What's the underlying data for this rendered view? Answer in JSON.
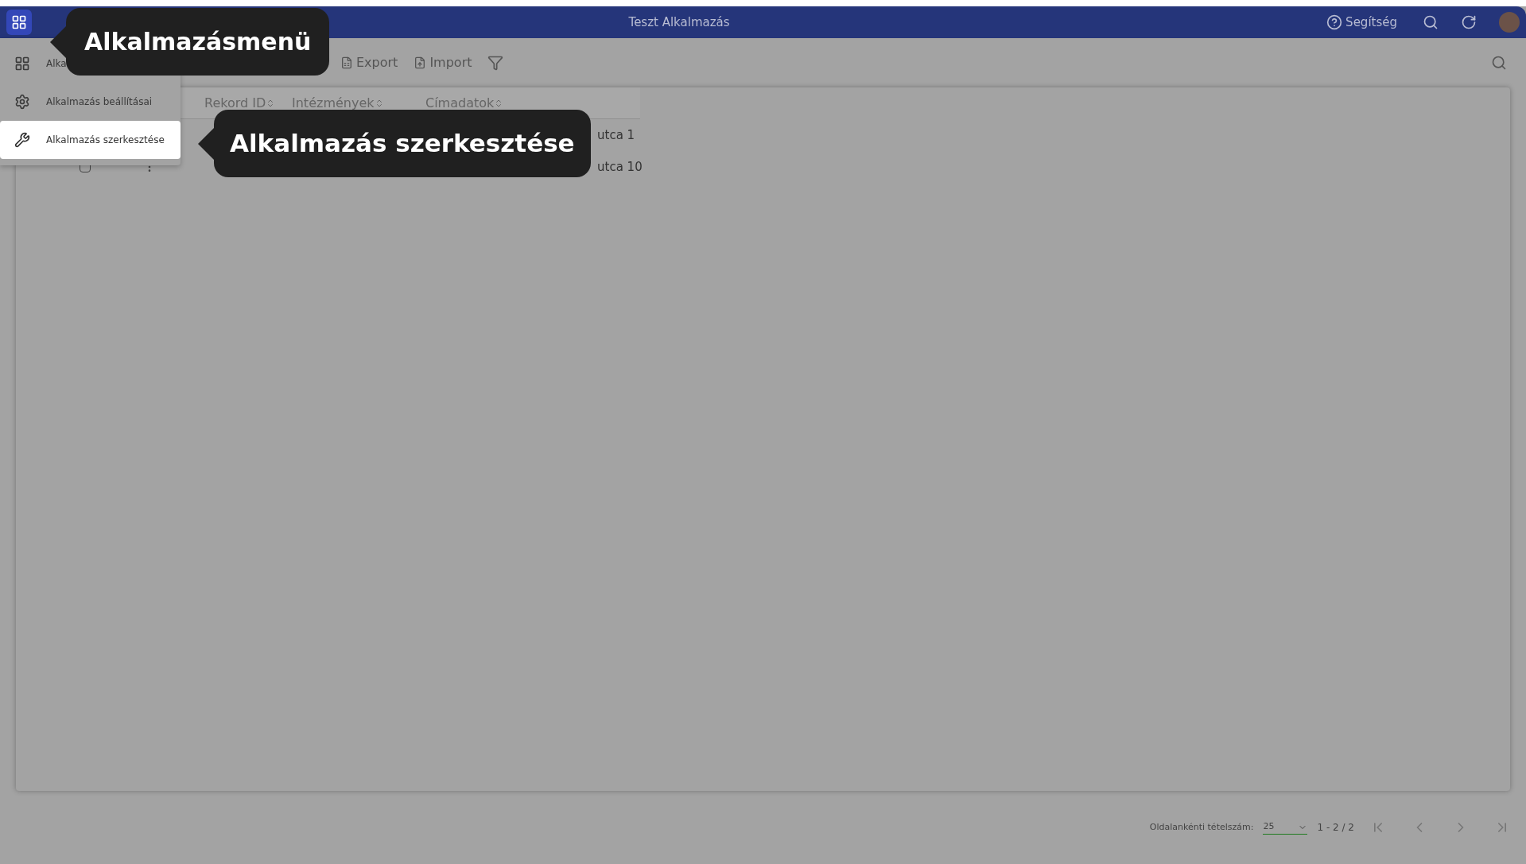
{
  "header": {
    "title": "Teszt Alkalmazás",
    "help": "Segítség"
  },
  "toolbar": {
    "buttons": [
      {
        "kind": "export",
        "label": "Export"
      },
      {
        "kind": "import",
        "label": "Import"
      }
    ]
  },
  "app_menu": {
    "items": [
      {
        "label": "Alka",
        "kind": "apps",
        "selected": false
      },
      {
        "label": "Alkalmazás beállításai",
        "kind": "settings",
        "selected": false
      },
      {
        "label": "Alkalmazás szerkesztése",
        "kind": "edit",
        "selected": true
      }
    ]
  },
  "table": {
    "columns": [
      "Rekord ID",
      "Intézmények",
      "Címadatok"
    ],
    "rows": [
      {
        "address": "utca 1"
      },
      {
        "address": "utca 10",
        "checked": false
      }
    ]
  },
  "pagination": {
    "label": "Oldalankénti tételszám:",
    "page_size": "25",
    "range": "1 - 2 / 2"
  },
  "tooltips": [
    {
      "kind": "top",
      "text": "Alkalmazásmenü"
    },
    {
      "kind": "item",
      "text": "Alkalmazás szerkesztése"
    }
  ]
}
